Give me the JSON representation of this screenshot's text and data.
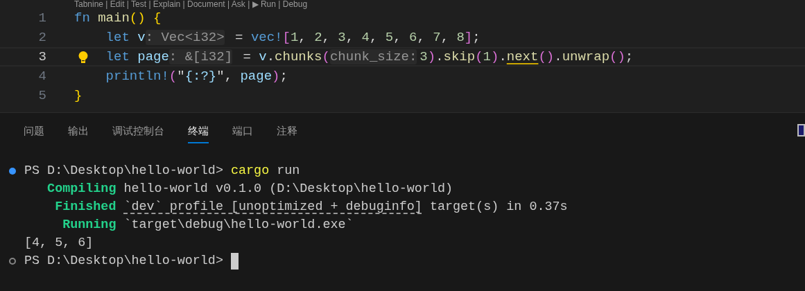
{
  "editor": {
    "codelens": "Tabnine | Edit | Test | Explain | Document | Ask | ▶ Run | Debug",
    "lines": [
      {
        "number": "1",
        "current": false,
        "lightbulb": false,
        "tokens": [
          {
            "text": "fn",
            "kind": "keyword"
          },
          {
            "text": " main",
            "kind": "function"
          },
          {
            "text": "()",
            "kind": "bracket1"
          },
          {
            "text": " {",
            "kind": "bracket1"
          }
        ]
      },
      {
        "number": "2",
        "current": false,
        "lightbulb": false,
        "tokens": [
          {
            "text": "    let",
            "kind": "keyword"
          },
          {
            "text": " v",
            "kind": "variable"
          },
          {
            "text": ": Vec<i32>",
            "kind": "inlay"
          },
          {
            "text": " = ",
            "kind": "plain"
          },
          {
            "text": "vec!",
            "kind": "macro"
          },
          {
            "text": "[",
            "kind": "bracket2"
          },
          {
            "text": "1",
            "kind": "number"
          },
          {
            "text": ", ",
            "kind": "plain"
          },
          {
            "text": "2",
            "kind": "number"
          },
          {
            "text": ", ",
            "kind": "plain"
          },
          {
            "text": "3",
            "kind": "number"
          },
          {
            "text": ", ",
            "kind": "plain"
          },
          {
            "text": "4",
            "kind": "number"
          },
          {
            "text": ", ",
            "kind": "plain"
          },
          {
            "text": "5",
            "kind": "number"
          },
          {
            "text": ", ",
            "kind": "plain"
          },
          {
            "text": "6",
            "kind": "number"
          },
          {
            "text": ", ",
            "kind": "plain"
          },
          {
            "text": "7",
            "kind": "number"
          },
          {
            "text": ", ",
            "kind": "plain"
          },
          {
            "text": "8",
            "kind": "number"
          },
          {
            "text": "]",
            "kind": "bracket2"
          },
          {
            "text": ";",
            "kind": "plain"
          }
        ]
      },
      {
        "number": "3",
        "current": true,
        "lightbulb": true,
        "tokens": [
          {
            "text": "    let",
            "kind": "keyword"
          },
          {
            "text": " page",
            "kind": "variable"
          },
          {
            "text": ": &[i32]",
            "kind": "inlay"
          },
          {
            "text": " = ",
            "kind": "plain"
          },
          {
            "text": "v",
            "kind": "variable"
          },
          {
            "text": ".",
            "kind": "plain"
          },
          {
            "text": "chunks",
            "kind": "function"
          },
          {
            "text": "(",
            "kind": "bracket2"
          },
          {
            "text": "chunk_size:",
            "kind": "inlay"
          },
          {
            "text": "3",
            "kind": "number"
          },
          {
            "text": ")",
            "kind": "bracket2"
          },
          {
            "text": ".",
            "kind": "plain"
          },
          {
            "text": "skip",
            "kind": "function"
          },
          {
            "text": "(",
            "kind": "bracket2"
          },
          {
            "text": "1",
            "kind": "number"
          },
          {
            "text": ")",
            "kind": "bracket2"
          },
          {
            "text": ".",
            "kind": "plain"
          },
          {
            "text": "next",
            "kind": "warning"
          },
          {
            "text": "()",
            "kind": "bracket2"
          },
          {
            "text": ".",
            "kind": "plain"
          },
          {
            "text": "unwrap",
            "kind": "function"
          },
          {
            "text": "()",
            "kind": "bracket2"
          },
          {
            "text": ";",
            "kind": "plain"
          }
        ]
      },
      {
        "number": "4",
        "current": false,
        "lightbulb": false,
        "tokens": [
          {
            "text": "    println!",
            "kind": "macro"
          },
          {
            "text": "(",
            "kind": "bracket2"
          },
          {
            "text": "\"",
            "kind": "string"
          },
          {
            "text": "{:?}",
            "kind": "format"
          },
          {
            "text": "\"",
            "kind": "string"
          },
          {
            "text": ", ",
            "kind": "plain"
          },
          {
            "text": "page",
            "kind": "variable"
          },
          {
            "text": ")",
            "kind": "bracket2"
          },
          {
            "text": ";",
            "kind": "plain"
          }
        ]
      },
      {
        "number": "5",
        "current": false,
        "lightbulb": false,
        "tokens": [
          {
            "text": "}",
            "kind": "bracket1"
          }
        ]
      }
    ]
  },
  "panel": {
    "tabs": [
      {
        "label": "问题",
        "selected": false
      },
      {
        "label": "输出",
        "selected": false
      },
      {
        "label": "调试控制台",
        "selected": false
      },
      {
        "label": "终端",
        "selected": true
      },
      {
        "label": "端口",
        "selected": false
      },
      {
        "label": "注释",
        "selected": false
      }
    ],
    "terminal": {
      "lines": [
        {
          "kind": "command",
          "succeeded": true,
          "cursor": false,
          "tokens": [
            {
              "text": "PS D:\\Desktop\\hello-world> ",
              "kind": "text"
            },
            {
              "text": "cargo",
              "kind": "command"
            },
            {
              "text": " run",
              "kind": "text"
            }
          ]
        },
        {
          "kind": "output",
          "cursor": false,
          "tokens": [
            {
              "text": "   Compiling",
              "kind": "status"
            },
            {
              "text": " hello-world v0.1.0 (D:\\Desktop\\hello-world)",
              "kind": "text"
            }
          ]
        },
        {
          "kind": "output",
          "cursor": false,
          "tokens": [
            {
              "text": "    Finished ",
              "kind": "status"
            },
            {
              "text": "`dev` profile [unoptimized + debuginfo]",
              "kind": "link"
            },
            {
              "text": " target(s) in 0.37s",
              "kind": "text"
            }
          ]
        },
        {
          "kind": "output",
          "cursor": false,
          "tokens": [
            {
              "text": "     Running",
              "kind": "status"
            },
            {
              "text": " `target\\debug\\hello-world.exe`",
              "kind": "text"
            }
          ]
        },
        {
          "kind": "output",
          "cursor": false,
          "tokens": [
            {
              "text": "[4, 5, 6]",
              "kind": "text"
            }
          ]
        },
        {
          "kind": "command",
          "succeeded": false,
          "cursor": true,
          "tokens": [
            {
              "text": "PS D:\\Desktop\\hello-world> ",
              "kind": "text"
            }
          ]
        }
      ]
    }
  }
}
